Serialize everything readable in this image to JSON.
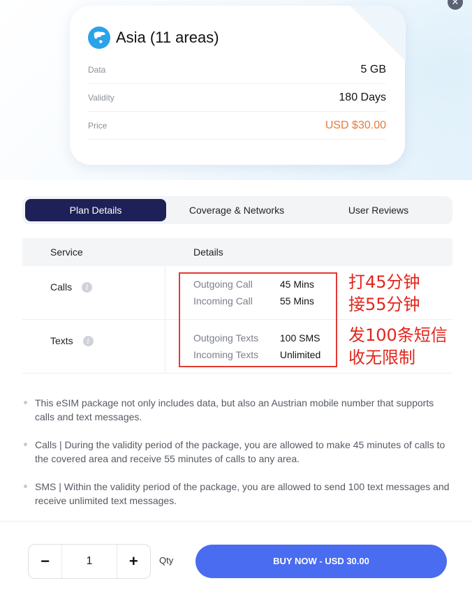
{
  "plan": {
    "title": "Asia (11 areas)",
    "rows": [
      {
        "key": "Data",
        "value": "5 GB"
      },
      {
        "key": "Validity",
        "value": "180 Days"
      },
      {
        "key": "Price",
        "value": "USD $30.00"
      }
    ]
  },
  "tabs": [
    {
      "label": "Plan Details",
      "active": true
    },
    {
      "label": "Coverage & Networks",
      "active": false
    },
    {
      "label": "User Reviews",
      "active": false
    }
  ],
  "table": {
    "headers": [
      "Service",
      "Details"
    ],
    "rows": [
      {
        "service": "Calls",
        "details": [
          {
            "label": "Outgoing Call",
            "value": "45 Mins"
          },
          {
            "label": "Incoming Call",
            "value": "55 Mins"
          }
        ]
      },
      {
        "service": "Texts",
        "details": [
          {
            "label": "Outgoing Texts",
            "value": "100 SMS"
          },
          {
            "label": "Incoming Texts",
            "value": "Unlimited"
          }
        ]
      }
    ]
  },
  "annotations": {
    "calls_line1": "打45分钟",
    "calls_line2": "接55分钟",
    "texts_line1": "发100条短信",
    "texts_line2": "收无限制",
    "color": "#e3251d"
  },
  "notes": [
    "This eSIM package not only includes data, but also an Austrian mobile number that supports calls and text messages.",
    "Calls | During the validity period of the package, you are allowed to make 45 minutes of calls to the covered area and receive 55 minutes of calls to any area.",
    "SMS | Within the validity period of the package, you are allowed to send 100 text messages and receive unlimited text messages."
  ],
  "footer": {
    "minus": "−",
    "quantity": "1",
    "plus": "+",
    "qty_label": "Qty",
    "buy_label": "BUY NOW - USD 30.00"
  },
  "icons": {
    "close": "close-icon",
    "globe": "globe-icon",
    "info": "info-icon"
  },
  "colors": {
    "accent": "#4a6cf0",
    "tab_active": "#1e2157",
    "price": "#e8793c"
  }
}
